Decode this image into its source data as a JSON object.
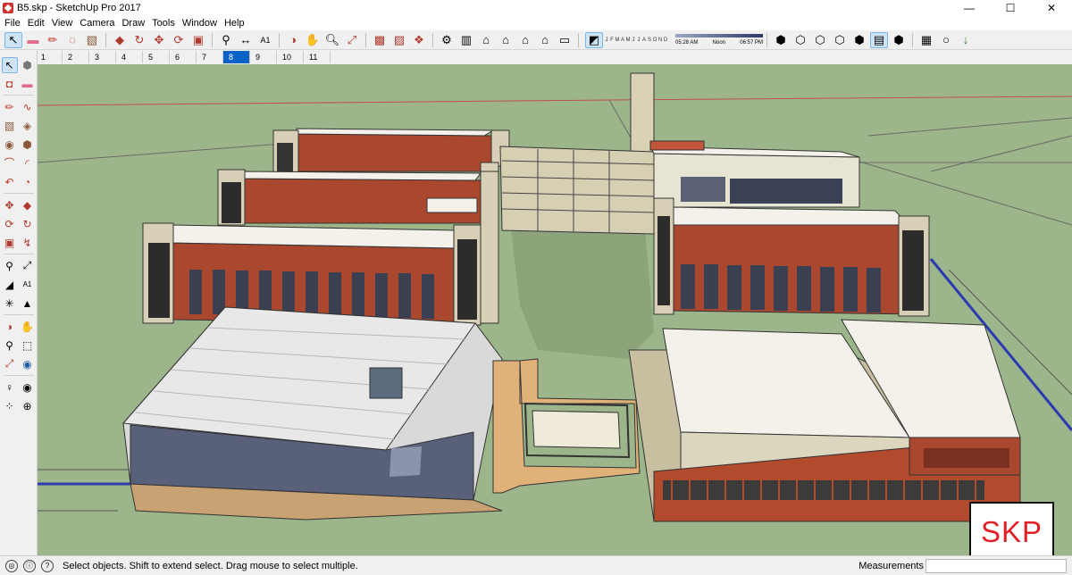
{
  "window": {
    "title": "B5.skp - SketchUp Pro 2017",
    "minimize": "—",
    "maximize": "☐",
    "close": "✕"
  },
  "menu": [
    "File",
    "Edit",
    "View",
    "Camera",
    "Draw",
    "Tools",
    "Window",
    "Help"
  ],
  "shadow": {
    "months": [
      "J",
      "F",
      "M",
      "A",
      "M",
      "J",
      "J",
      "A",
      "S",
      "O",
      "N",
      "D"
    ],
    "time_start": "05:28 AM",
    "time_mid": "Noon",
    "time_end": "06:57 PM"
  },
  "scenes": [
    "1",
    "2",
    "3",
    "4",
    "5",
    "6",
    "7",
    "8",
    "9",
    "10",
    "11"
  ],
  "active_scene": "8",
  "status": {
    "message": "Select objects. Shift to extend select. Drag mouse to select multiple.",
    "measurements_label": "Measurements"
  },
  "badge": {
    "text": "SKP"
  },
  "colors": {
    "ground": "#9db58a",
    "brick": "#a9482f",
    "roof": "#f3f1ea",
    "accent": "#e01f26"
  }
}
